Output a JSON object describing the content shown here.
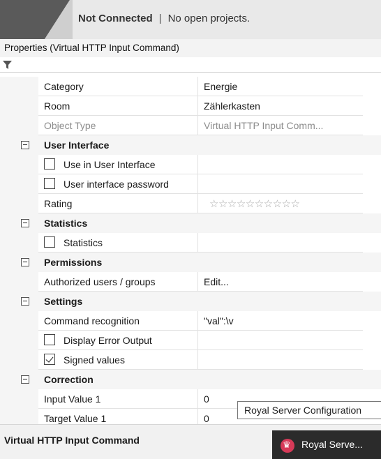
{
  "topbar": {
    "connection": "Not Connected",
    "separator": "|",
    "projects": "No open projects."
  },
  "panel": {
    "title": "Properties (Virtual HTTP Input Command)"
  },
  "grid": {
    "category_row": {
      "name": "Category",
      "value": "Energie"
    },
    "room_row": {
      "name": "Room",
      "value": "Zählerkasten"
    },
    "object_type_row": {
      "name": "Object Type",
      "value": "Virtual HTTP Input Comm..."
    },
    "ui_section": "User Interface",
    "use_in_ui": {
      "label": "Use in User Interface",
      "checked": false
    },
    "ui_password": {
      "label": "User interface password",
      "checked": false
    },
    "rating": {
      "name": "Rating",
      "stars": "☆☆☆☆☆☆☆☆☆☆",
      "value": 0,
      "max": 10
    },
    "statistics_section": "Statistics",
    "statistics": {
      "label": "Statistics",
      "checked": false
    },
    "permissions_section": "Permissions",
    "authorized": {
      "name": "Authorized users / groups",
      "value": "Edit..."
    },
    "settings_section": "Settings",
    "command_recognition": {
      "name": "Command recognition",
      "value": "\"val\":\\v"
    },
    "display_error_output": {
      "label": "Display Error Output",
      "checked": false
    },
    "signed_values": {
      "label": "Signed values",
      "checked": true
    },
    "correction_section": "Correction",
    "input_value_1": {
      "name": "Input Value 1",
      "value": "0"
    },
    "target_value_1": {
      "name": "Target Value 1",
      "value": "0"
    }
  },
  "tooltip": {
    "text": "Royal Server Configuration"
  },
  "footer": {
    "title": "Virtual HTTP Input Command",
    "taskbar_label": "Royal Serve..."
  }
}
